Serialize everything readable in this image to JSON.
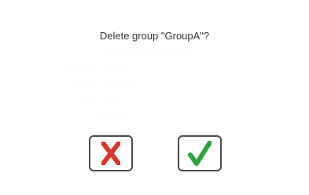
{
  "dialog": {
    "message": "Delete group \"GroupA\"?",
    "cancel_icon": "x-icon",
    "confirm_icon": "check-icon"
  },
  "colors": {
    "cancel": "#d9352b",
    "confirm": "#2aa33a",
    "button_border": "#4a4a4a"
  }
}
